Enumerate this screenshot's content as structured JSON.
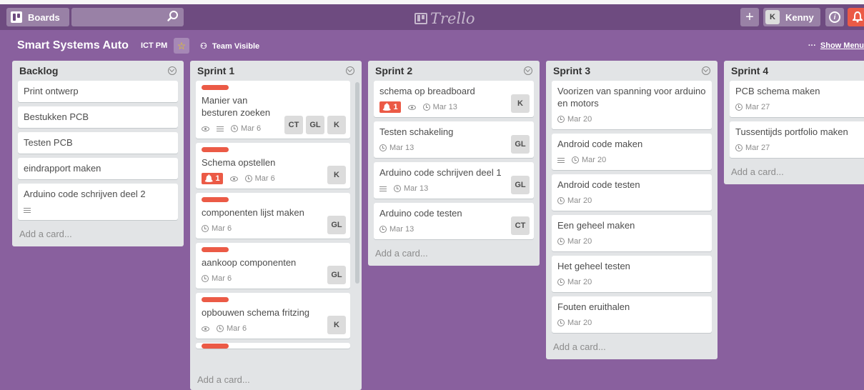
{
  "header": {
    "boards_label": "Boards",
    "search_placeholder": "",
    "logo_text": "Trello",
    "user_initial": "K",
    "user_name": "Kenny"
  },
  "board": {
    "title": "Smart Systems Auto",
    "org": "ICT PM",
    "visibility": "Team Visible",
    "show_menu_dots": "···",
    "show_menu": "Show Menu"
  },
  "colors": {
    "background": "#89609e",
    "topbar": "#6e4b80",
    "label_red": "#eb5a46",
    "star": "#f2d600"
  },
  "lists": [
    {
      "title": "Backlog",
      "add_card": "Add a card...",
      "cards": [
        {
          "title": "Print ontwerp"
        },
        {
          "title": "Bestukken PCB"
        },
        {
          "title": "Testen PCB"
        },
        {
          "title": "eindrapport maken"
        },
        {
          "title": "Arduino code schrijven deel 2",
          "desc_icon": true
        }
      ]
    },
    {
      "title": "Sprint 1",
      "add_card": "Add a card...",
      "cards": [
        {
          "title": "Manier van besturen zoeken",
          "label": "red",
          "eye": true,
          "desc_icon": true,
          "due": "Mar 6",
          "members": [
            "CT",
            "GL",
            "K"
          ]
        },
        {
          "title": "Schema opstellen",
          "label": "red",
          "alert": "1",
          "eye": true,
          "due": "Mar 6",
          "members": [
            "K"
          ]
        },
        {
          "title": "componenten lijst maken",
          "label": "red",
          "due": "Mar 6",
          "members": [
            "GL"
          ]
        },
        {
          "title": "aankoop componenten",
          "label": "red",
          "due": "Mar 6",
          "members": [
            "GL"
          ]
        },
        {
          "title": "opbouwen schema fritzing",
          "label": "red",
          "eye": true,
          "due": "Mar 6",
          "members": [
            "K"
          ]
        },
        {
          "title": "",
          "label": "red",
          "cut": true
        }
      ]
    },
    {
      "title": "Sprint 2",
      "add_card": "Add a card...",
      "cards": [
        {
          "title": "schema op breadboard",
          "alert": "1",
          "eye": true,
          "due": "Mar 13",
          "members": [
            "K"
          ]
        },
        {
          "title": "Testen schakeling",
          "due": "Mar 13",
          "members": [
            "GL"
          ]
        },
        {
          "title": "Arduino code schrijven deel 1",
          "desc_icon": true,
          "due": "Mar 13",
          "members": [
            "GL"
          ]
        },
        {
          "title": "Arduino code testen",
          "due": "Mar 13",
          "members": [
            "CT"
          ]
        }
      ]
    },
    {
      "title": "Sprint 3",
      "add_card": "Add a card...",
      "cards": [
        {
          "title": "Voorizen van spanning voor arduino en motors",
          "due": "Mar 20"
        },
        {
          "title": "Android code maken",
          "desc_icon": true,
          "due": "Mar 20"
        },
        {
          "title": "Android code testen",
          "due": "Mar 20"
        },
        {
          "title": "Een geheel maken",
          "due": "Mar 20"
        },
        {
          "title": "Het geheel testen",
          "due": "Mar 20"
        },
        {
          "title": "Fouten eruithalen",
          "due": "Mar 20"
        }
      ]
    },
    {
      "title": "Sprint 4",
      "add_card": "Add a card...",
      "cards": [
        {
          "title": "PCB schema maken",
          "due": "Mar 27"
        },
        {
          "title": "Tussentijds portfolio maken",
          "due": "Mar 27"
        }
      ]
    }
  ]
}
